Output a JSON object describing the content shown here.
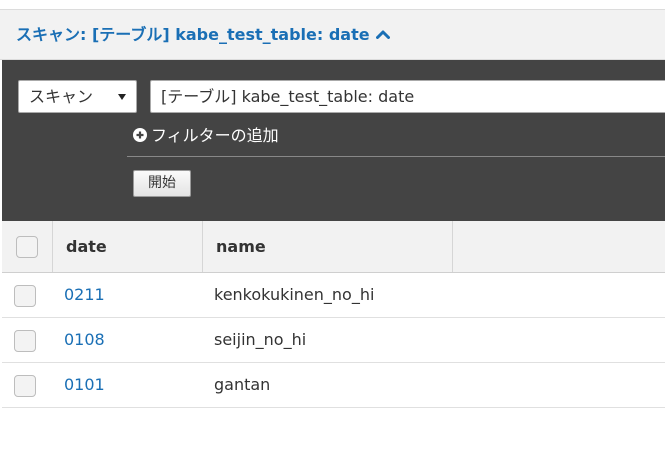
{
  "header": {
    "title": "スキャン: [テーブル] kabe_test_table: date",
    "collapse_icon": "chevron-up-icon"
  },
  "query": {
    "operation": "スキャン",
    "target": "[テーブル] kabe_test_table: date",
    "add_filter_label": "フィルターの追加",
    "start_label": "開始"
  },
  "table": {
    "columns": [
      "date",
      "name"
    ],
    "rows": [
      {
        "date": "0211",
        "name": "kenkokukinen_no_hi"
      },
      {
        "date": "0108",
        "name": "seijin_no_hi"
      },
      {
        "date": "0101",
        "name": "gantan"
      }
    ]
  },
  "colors": {
    "accent": "#1a6fb5",
    "panel": "#444444",
    "header_bg": "#f2f2f2"
  }
}
